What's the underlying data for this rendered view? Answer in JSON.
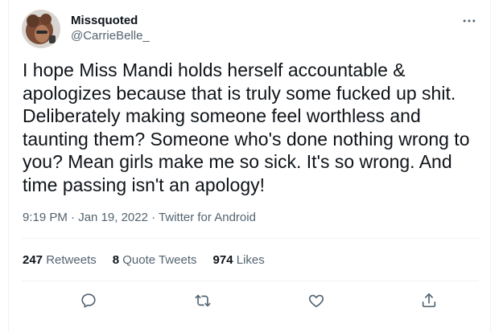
{
  "user": {
    "display_name": "Missquoted",
    "handle": "@CarrieBelle_"
  },
  "tweet": {
    "text": "I hope Miss Mandi holds herself accountable & apologizes because that is truly some fucked up shit. Deliberately making someone feel worthless and taunting them? Someone who's done nothing wrong to you? Mean girls make me so sick. It's so wrong. And time passing isn't an apology!",
    "time": "9:19 PM",
    "date": "Jan 19, 2022",
    "source": "Twitter for Android",
    "sep": " · "
  },
  "stats": {
    "retweets": {
      "count": "247",
      "label": "Retweets"
    },
    "quotes": {
      "count": "8",
      "label": "Quote Tweets"
    },
    "likes": {
      "count": "974",
      "label": "Likes"
    }
  },
  "icons": {
    "more": "more-horizontal-icon",
    "reply": "reply-icon",
    "retweet": "retweet-icon",
    "like": "heart-icon",
    "share": "share-icon"
  },
  "colors": {
    "text": "#0f1419",
    "secondary": "#536471",
    "border": "#eff3f4"
  }
}
